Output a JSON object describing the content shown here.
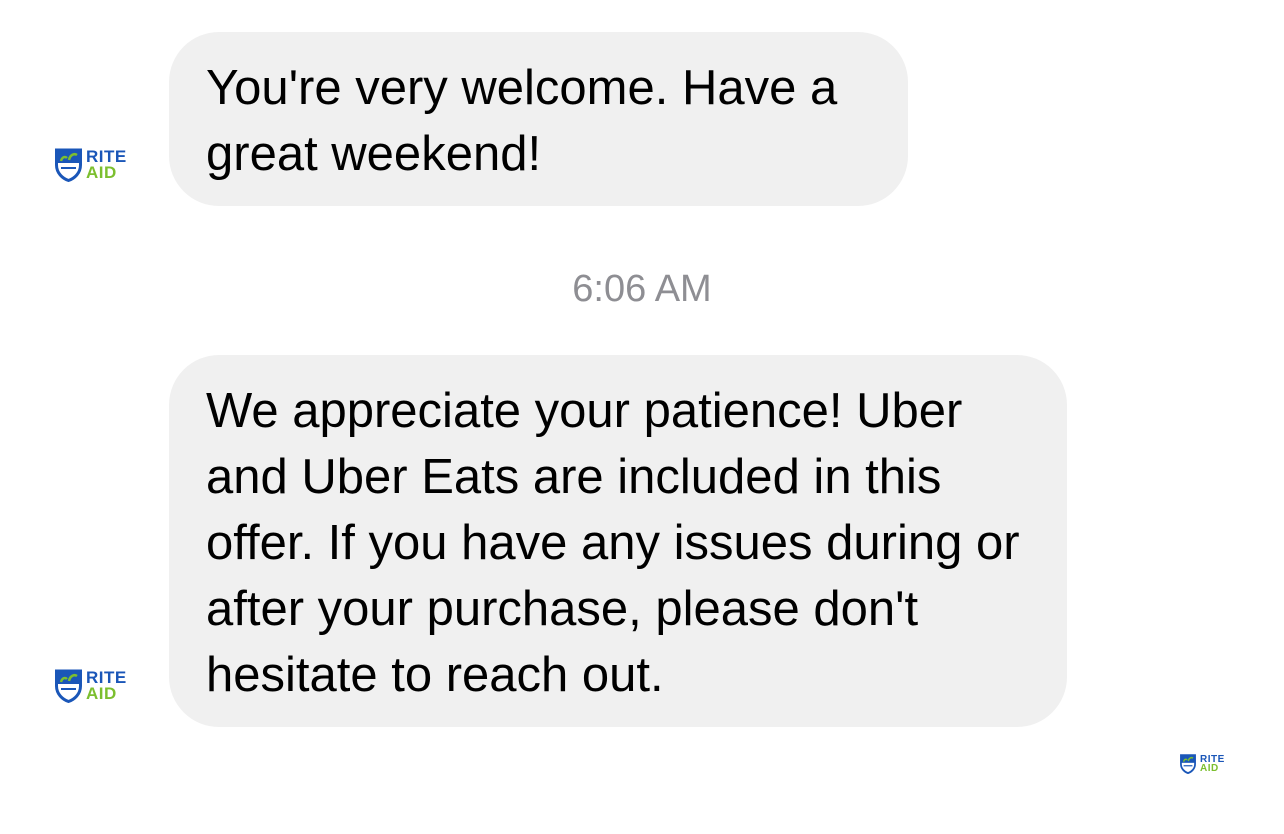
{
  "messages": [
    {
      "text": "You're very welcome. Have a great weekend!",
      "sender_logo": {
        "line1": "RITE",
        "line2": "AID",
        "icon": "rite-aid-shield-icon"
      }
    },
    {
      "text": "We appreciate your patience! Uber and Uber Eats are included in this offer. If you have any issues during or after your purchase, please don't hesitate to reach out.",
      "sender_logo": {
        "line1": "RITE",
        "line2": "AID",
        "icon": "rite-aid-shield-icon"
      }
    }
  ],
  "timestamp": "6:06 AM",
  "read_receipt_logo": {
    "line1": "RITE",
    "line2": "AID",
    "icon": "rite-aid-shield-icon"
  },
  "colors": {
    "bubble_bg": "#f0f0f0",
    "timestamp": "#8e8e93",
    "brand_blue": "#1a56b8",
    "brand_green": "#7cbf2f"
  }
}
